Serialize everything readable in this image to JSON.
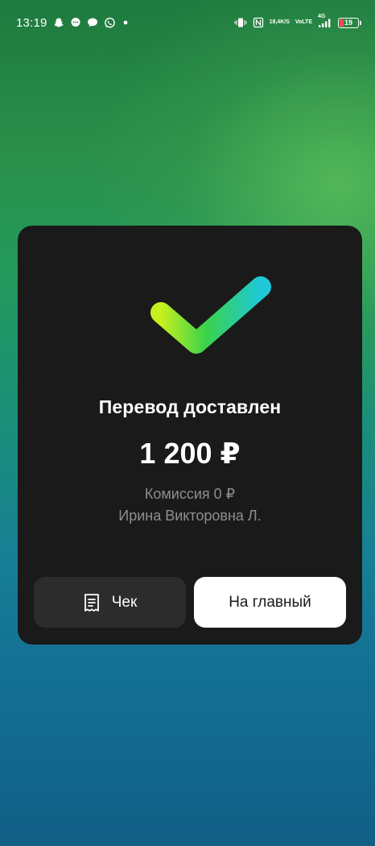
{
  "status_bar": {
    "time": "13:19",
    "left_icons": [
      "snapchat-icon",
      "chat-bubble-icon",
      "message-icon",
      "whatsapp-icon",
      "dot-icon"
    ],
    "network_speed": "19,4",
    "network_speed_unit": "K/S",
    "volte_top": "Vo",
    "volte_bottom": "LTE",
    "network_type": "4G",
    "battery_level": "19",
    "battery_color": "#ff4d4d"
  },
  "card": {
    "title": "Перевод доставлен",
    "amount": "1 200 ₽",
    "commission": "Комиссия 0 ₽",
    "recipient": "Ирина Викторовна Л.",
    "receipt_button_label": "Чек",
    "home_button_label": "На главный",
    "check_gradient": [
      "#c6f01e",
      "#3ad24a",
      "#1ec8d8"
    ]
  }
}
